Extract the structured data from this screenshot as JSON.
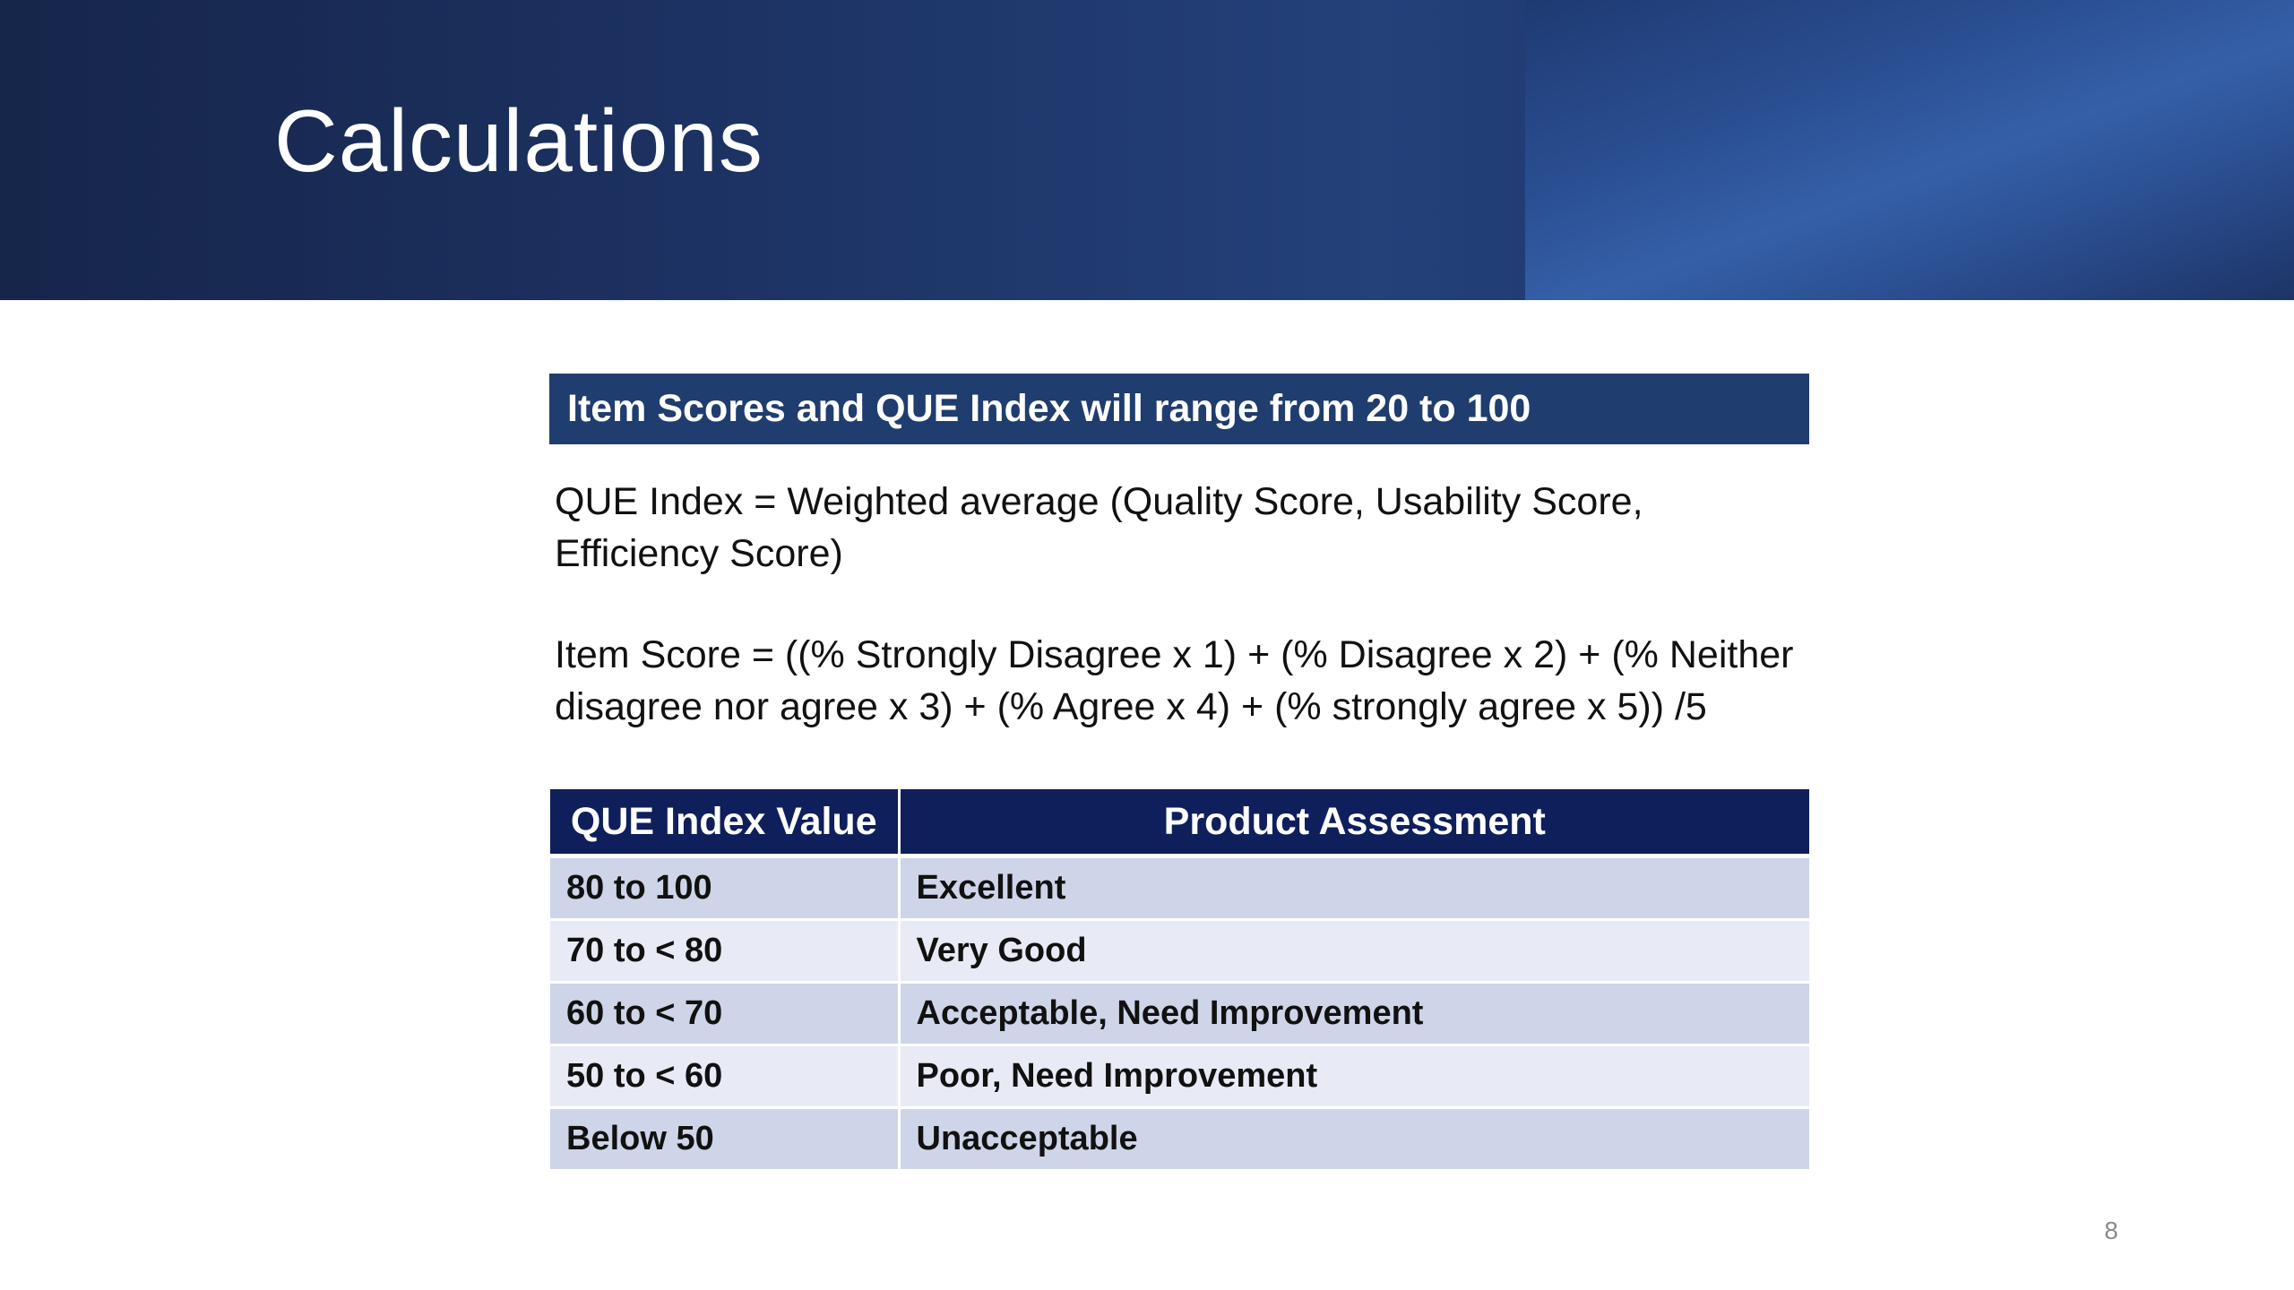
{
  "slide": {
    "title": "Calculations",
    "page_number": "8"
  },
  "banner": {
    "text": "Item Scores and QUE Index will range from 20 to 100"
  },
  "paragraphs": {
    "que_index": "QUE Index = Weighted average (Quality Score, Usability Score, Efficiency Score)",
    "item_score": "Item Score = ((% Strongly Disagree x 1) + (% Disagree x 2) + (% Neither disagree nor agree x 3) + (% Agree x 4) + (% strongly agree x 5)) /5"
  },
  "table": {
    "headers": [
      "QUE Index Value",
      "Product Assessment"
    ],
    "rows": [
      [
        "80 to 100",
        "Excellent"
      ],
      [
        "70 to < 80",
        "Very Good"
      ],
      [
        "60 to < 70",
        "Acceptable, Need Improvement"
      ],
      [
        "50 to < 60",
        "Poor, Need Improvement"
      ],
      [
        "Below 50",
        "Unacceptable"
      ]
    ]
  },
  "colors": {
    "header_band": "#1d3466",
    "banner": "#1f3d6e",
    "table_header": "#0f1f5c",
    "row_dark": "#cfd5e8",
    "row_light": "#e8ebf5"
  }
}
